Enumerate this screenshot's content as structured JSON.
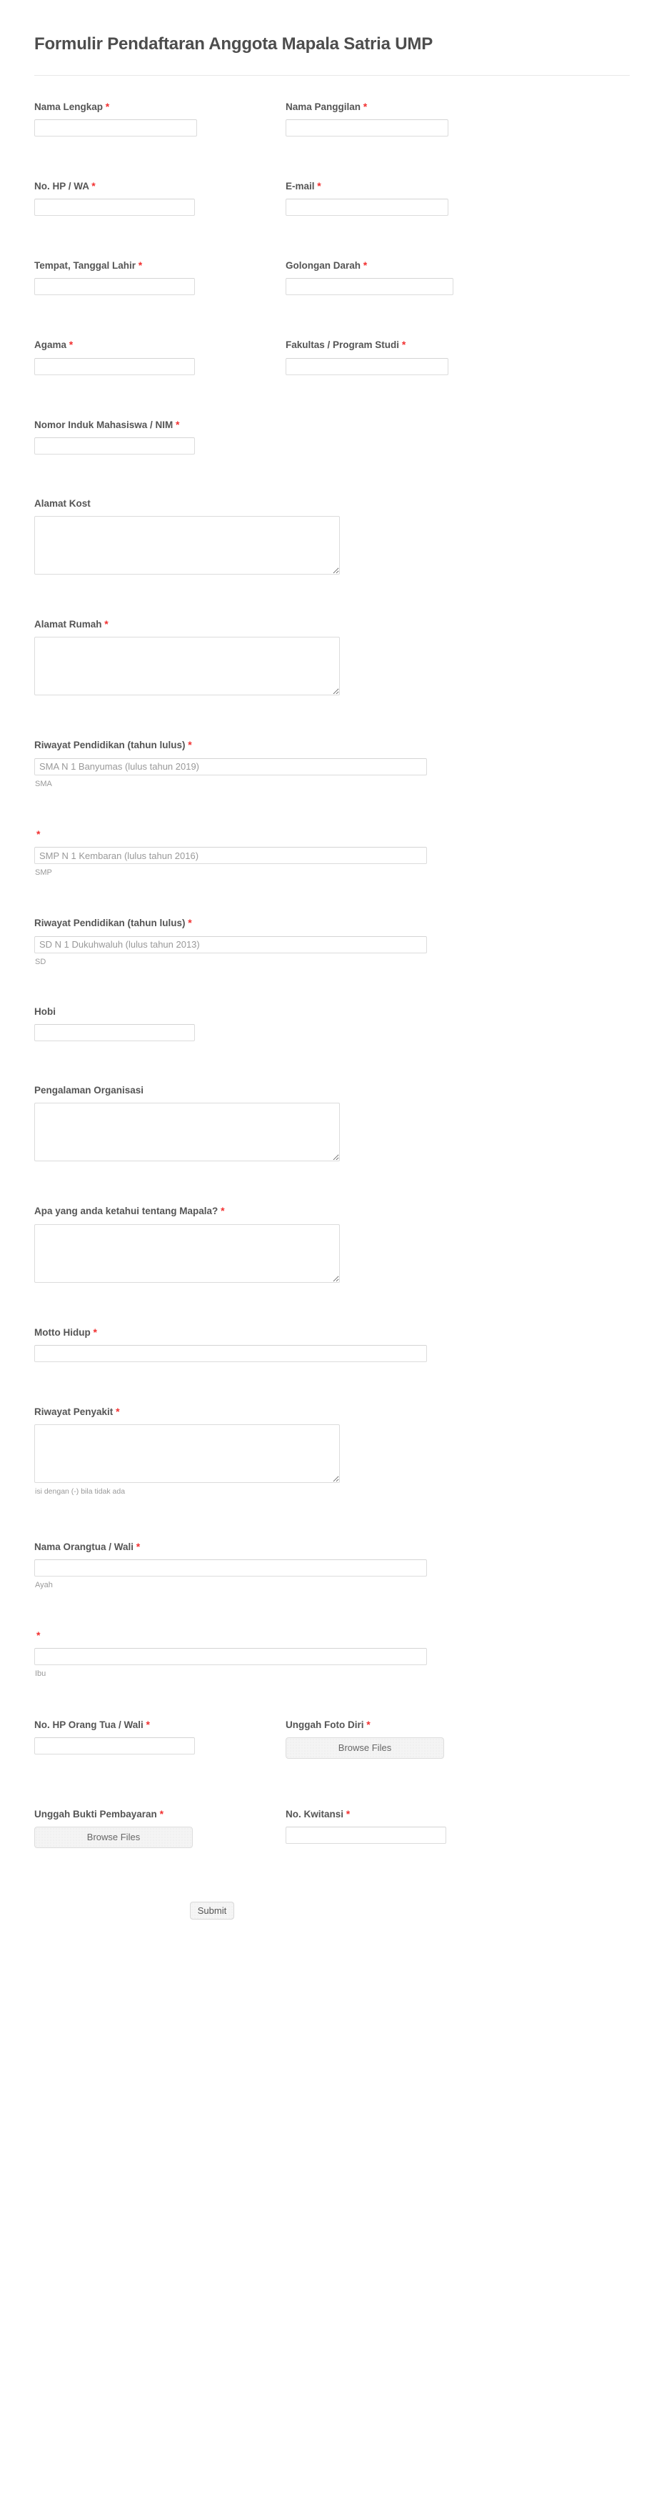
{
  "form": {
    "title": "Formulir Pendaftaran Anggota Mapala Satria UMP",
    "required_marker": "*",
    "accent_required_color": "#f23030",
    "label_color": "#555555",
    "input_border_color": "#dcdcdc",
    "placeholder_color": "#999999"
  },
  "fields": {
    "nama_lengkap": {
      "label": "Nama Lengkap",
      "required": true,
      "value": "",
      "placeholder": ""
    },
    "nama_panggilan": {
      "label": "Nama Panggilan",
      "required": true,
      "value": "",
      "placeholder": ""
    },
    "no_hp_wa": {
      "label": "No. HP / WA",
      "required": true,
      "value": "",
      "placeholder": ""
    },
    "email": {
      "label": "E-mail",
      "required": true,
      "value": "",
      "placeholder": ""
    },
    "tempat_tanggal_lahir": {
      "label": "Tempat, Tanggal Lahir",
      "required": true,
      "value": "",
      "placeholder": ""
    },
    "golongan_darah": {
      "label": "Golongan Darah",
      "required": true,
      "value": "",
      "placeholder": ""
    },
    "agama": {
      "label": "Agama",
      "required": true,
      "value": "",
      "placeholder": ""
    },
    "fakultas_program_studi": {
      "label": "Fakultas / Program Studi",
      "required": true,
      "value": "",
      "placeholder": ""
    },
    "nim": {
      "label": "Nomor Induk Mahasiswa / NIM",
      "required": true,
      "value": "",
      "placeholder": ""
    },
    "alamat_kost": {
      "label": "Alamat Kost",
      "required": false,
      "value": "",
      "placeholder": ""
    },
    "alamat_rumah": {
      "label": "Alamat Rumah",
      "required": true,
      "value": "",
      "placeholder": ""
    },
    "pendidikan_sma": {
      "label": "Riwayat Pendidikan (tahun lulus)",
      "required": true,
      "value": "",
      "placeholder": "SMA N 1 Banyumas (lulus tahun 2019)",
      "sublabel": "SMA"
    },
    "pendidikan_smp": {
      "label": "",
      "required": true,
      "value": "",
      "placeholder": "SMP N 1 Kembaran (lulus tahun 2016)",
      "sublabel": "SMP"
    },
    "pendidikan_sd": {
      "label": "Riwayat Pendidikan (tahun lulus)",
      "required": true,
      "value": "",
      "placeholder": "SD N 1 Dukuhwaluh (lulus tahun 2013)",
      "sublabel": "SD"
    },
    "hobi": {
      "label": "Hobi",
      "required": false,
      "value": "",
      "placeholder": ""
    },
    "pengalaman_organisasi": {
      "label": "Pengalaman Organisasi",
      "required": false,
      "value": "",
      "placeholder": ""
    },
    "tentang_mapala": {
      "label": "Apa yang anda ketahui tentang Mapala?",
      "required": true,
      "value": "",
      "placeholder": ""
    },
    "motto_hidup": {
      "label": "Motto Hidup",
      "required": true,
      "value": "",
      "placeholder": ""
    },
    "riwayat_penyakit": {
      "label": "Riwayat Penyakit",
      "required": true,
      "value": "",
      "placeholder": "",
      "hint": "isi dengan (-) bila tidak ada"
    },
    "nama_orangtua_ayah": {
      "label": "Nama Orangtua / Wali",
      "required": true,
      "value": "",
      "placeholder": "",
      "sublabel": "Ayah"
    },
    "nama_orangtua_ibu": {
      "label": "",
      "required": true,
      "value": "",
      "placeholder": "",
      "sublabel": "Ibu"
    },
    "no_hp_orangtua": {
      "label": "No. HP Orang Tua / Wali",
      "required": true,
      "value": "",
      "placeholder": ""
    },
    "unggah_foto_diri": {
      "label": "Unggah Foto Diri",
      "required": true,
      "button_label": "Browse Files"
    },
    "unggah_bukti_pembayaran": {
      "label": "Unggah Bukti Pembayaran",
      "required": true,
      "button_label": "Browse Files"
    },
    "no_kwitansi": {
      "label": "No. Kwitansi",
      "required": true,
      "value": "",
      "placeholder": ""
    }
  },
  "actions": {
    "submit_label": "Submit"
  }
}
